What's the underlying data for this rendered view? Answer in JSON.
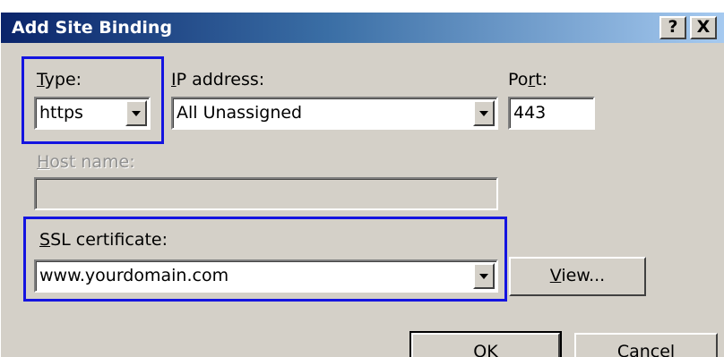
{
  "dialog": {
    "title": "Add Site Binding",
    "help_button": "?",
    "close_button": "X"
  },
  "fields": {
    "type": {
      "label_prefix": "",
      "label_mnemonic": "T",
      "label_rest": "ype:",
      "value": "https"
    },
    "ip_address": {
      "label_mnemonic": "I",
      "label_rest": "P address:",
      "value": "All Unassigned"
    },
    "port": {
      "label_start": "Po",
      "label_mnemonic": "r",
      "label_rest": "t:",
      "value": "443"
    },
    "host_name": {
      "label_mnemonic": "H",
      "label_rest": "ost name:",
      "value": ""
    },
    "ssl_certificate": {
      "label_mnemonic": "S",
      "label_rest": "SL certificate:",
      "value": "www.yourdomain.com"
    }
  },
  "buttons": {
    "view": {
      "mnemonic": "V",
      "rest": "iew..."
    },
    "ok": "OK",
    "cancel": "Cancel"
  },
  "colors": {
    "dialog_face": "#d4d0c8",
    "title_start": "#0a246a",
    "title_end": "#a6caf0",
    "highlight_box": "#1414e0"
  }
}
